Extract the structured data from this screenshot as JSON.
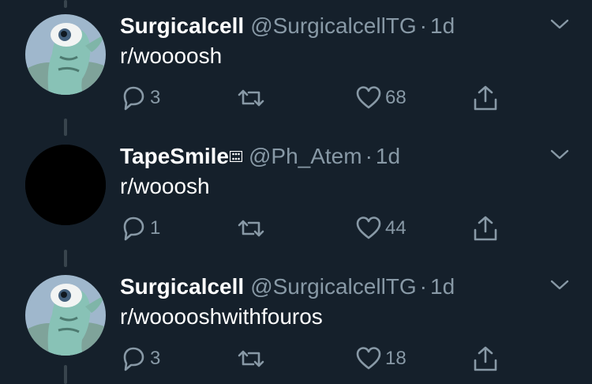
{
  "colors": {
    "background": "#15202b",
    "thread_line": "#38444d",
    "secondary_text": "#8899a6",
    "primary_text": "#ffffff"
  },
  "tweets": [
    {
      "avatar": "monster-avatar",
      "name": "Surgicalcell",
      "handle": "@SurgicalcellTG",
      "dot": "·",
      "time": "1d",
      "text": "r/woooosh",
      "replies": "3",
      "retweets": "",
      "likes": "68"
    },
    {
      "avatar": "black-avatar",
      "name": "TapeSmile",
      "badge_icon": "dice-emoji-icon",
      "handle": "@Ph_Atem",
      "dot": "·",
      "time": "1d",
      "text": "r/wooosh",
      "replies": "1",
      "retweets": "",
      "likes": "44"
    },
    {
      "avatar": "monster-avatar",
      "name": "Surgicalcell",
      "handle": "@SurgicalcellTG",
      "dot": "·",
      "time": "1d",
      "text": "r/wooooshwithfouros",
      "replies": "3",
      "retweets": "",
      "likes": "18"
    }
  ]
}
